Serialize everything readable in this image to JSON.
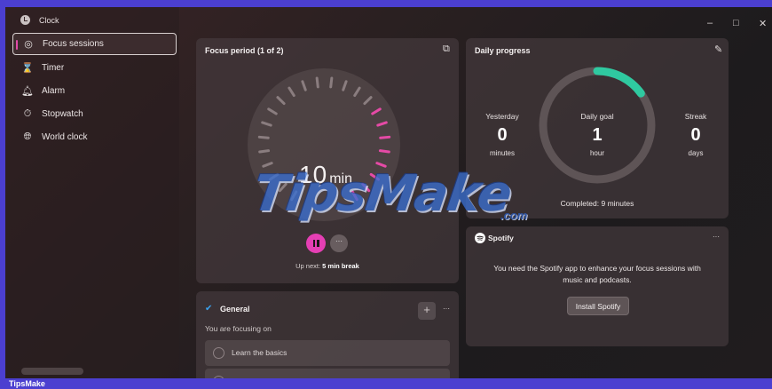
{
  "app": {
    "title": "Clock"
  },
  "window_controls": {
    "minimize": "–",
    "maximize": "□",
    "close": "✕"
  },
  "sidebar": {
    "items": [
      {
        "label": "Focus sessions",
        "icon": "focus-icon",
        "active": true
      },
      {
        "label": "Timer",
        "icon": "hourglass-icon"
      },
      {
        "label": "Alarm",
        "icon": "bell-icon"
      },
      {
        "label": "Stopwatch",
        "icon": "stopwatch-icon"
      },
      {
        "label": "World clock",
        "icon": "globe-icon"
      }
    ]
  },
  "focus": {
    "title": "Focus period (1 of 2)",
    "time_value": "10",
    "time_unit": "min",
    "upnext_prefix": "Up next:",
    "upnext_value": "5 min break",
    "more_label": "···",
    "progress": 0.33
  },
  "daily": {
    "title": "Daily progress",
    "yesterday": {
      "label": "Yesterday",
      "value": "0",
      "unit": "minutes"
    },
    "goal": {
      "label": "Daily goal",
      "value": "1",
      "unit": "hour"
    },
    "streak": {
      "label": "Streak",
      "value": "0",
      "unit": "days"
    },
    "completed": "Completed: 9 minutes",
    "ring_progress": 0.15,
    "ring_color": "#2fc9a0"
  },
  "spotify": {
    "brand": "Spotify",
    "more_label": "···",
    "message": "You need the Spotify app to enhance your focus sessions with music and podcasts.",
    "install_label": "Install Spotify"
  },
  "general": {
    "title": "General",
    "subtitle": "You are focusing on",
    "add_label": "+",
    "more_label": "···",
    "tasks": [
      "Learn the basics",
      ""
    ]
  },
  "watermark": {
    "text": "TipsMake",
    "suffix": ".com"
  },
  "footer": {
    "label": "TipsMake"
  },
  "colors": {
    "accent": "#e54aa6",
    "frame": "#4b3fd0"
  }
}
